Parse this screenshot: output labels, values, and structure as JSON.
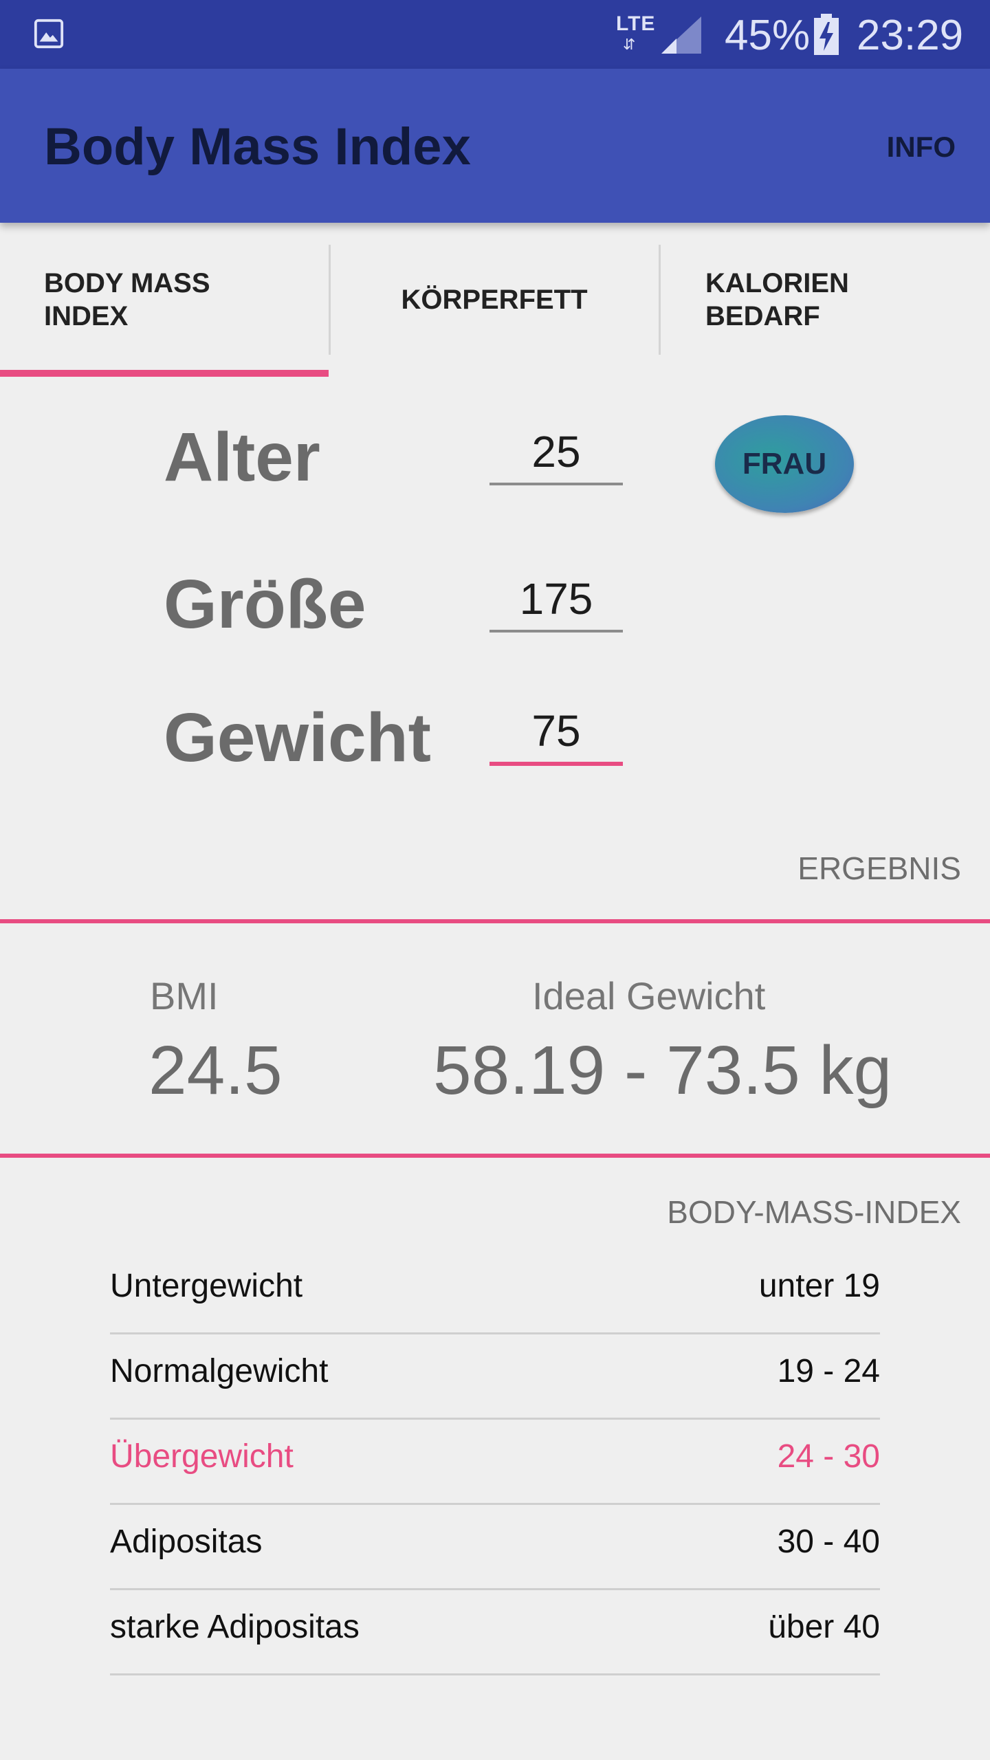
{
  "status_bar": {
    "network": "LTE",
    "battery_percent": "45%",
    "time": "23:29",
    "icons": [
      "image-icon",
      "lte-icon",
      "signal-icon",
      "battery-charging-icon"
    ]
  },
  "app_bar": {
    "title": "Body Mass Index",
    "action": "INFO"
  },
  "tabs": [
    {
      "label": "BODY MASS\nINDEX",
      "selected": true
    },
    {
      "label": "KÖRPERFETT",
      "selected": false
    },
    {
      "label": "KALORIEN\nBEDARF",
      "selected": false
    }
  ],
  "form": {
    "age_label": "Alter",
    "age_value": "25",
    "height_label": "Größe",
    "height_value": "175",
    "weight_label": "Gewicht",
    "weight_value": "75",
    "gender_button": "FRAU"
  },
  "result": {
    "header": "ERGEBNIS",
    "bmi_caption": "BMI",
    "bmi_value": "24.5",
    "ideal_caption": "Ideal Gewicht",
    "ideal_value": "58.19 - 73.5 kg"
  },
  "bmi_table": {
    "header": "BODY-MASS-INDEX",
    "rows": [
      {
        "category": "Untergewicht",
        "range": "unter 19",
        "highlighted": false
      },
      {
        "category": "Normalgewicht",
        "range": "19 - 24",
        "highlighted": false
      },
      {
        "category": "Übergewicht",
        "range": "24 - 30",
        "highlighted": true
      },
      {
        "category": "Adipositas",
        "range": "30 - 40",
        "highlighted": false
      },
      {
        "category": "starke Adipositas",
        "range": "über 40",
        "highlighted": false
      }
    ]
  },
  "colors": {
    "primary": "#3f51b5",
    "primary_dark": "#2d3c9e",
    "accent": "#e84c82",
    "background": "#efefef"
  }
}
